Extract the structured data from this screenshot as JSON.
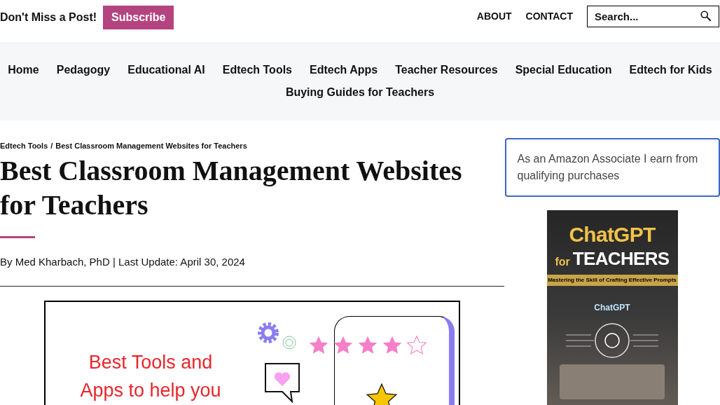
{
  "header": {
    "tagline": "Don't Miss a Post!",
    "subscribe": "Subscribe",
    "links": [
      "ABOUT",
      "CONTACT"
    ],
    "search": {
      "placeholder": "Search..."
    }
  },
  "nav": {
    "items": [
      "Home",
      "Pedagogy",
      "Educational AI",
      "Edtech Tools",
      "Edtech Apps",
      "Teacher Resources",
      "Special Education",
      "Edtech for Kids",
      "Buying Guides for Teachers"
    ]
  },
  "article": {
    "breadcrumb": [
      "Edtech Tools",
      "Best Classroom Management Websites for Teachers"
    ],
    "breadcrumb_separator": "/",
    "title": "Best Classroom Management Websites for Teachers",
    "byline": "By Med Kharbach, PhD | Last Update: April 30, 2024",
    "featured_image": {
      "lines": [
        "Best Tools and",
        "Apps to help you"
      ],
      "stars": 4
    }
  },
  "sidebar": {
    "notice": "As an Amazon Associate I earn from qualifying purchases",
    "book": {
      "title_1": "ChatGPT",
      "title_2": "for",
      "title_3": "TEACHERS",
      "subtitle": "Mastering the Skill of Crafting Effective Prompts",
      "screen_label": "ChatGPT"
    }
  }
}
